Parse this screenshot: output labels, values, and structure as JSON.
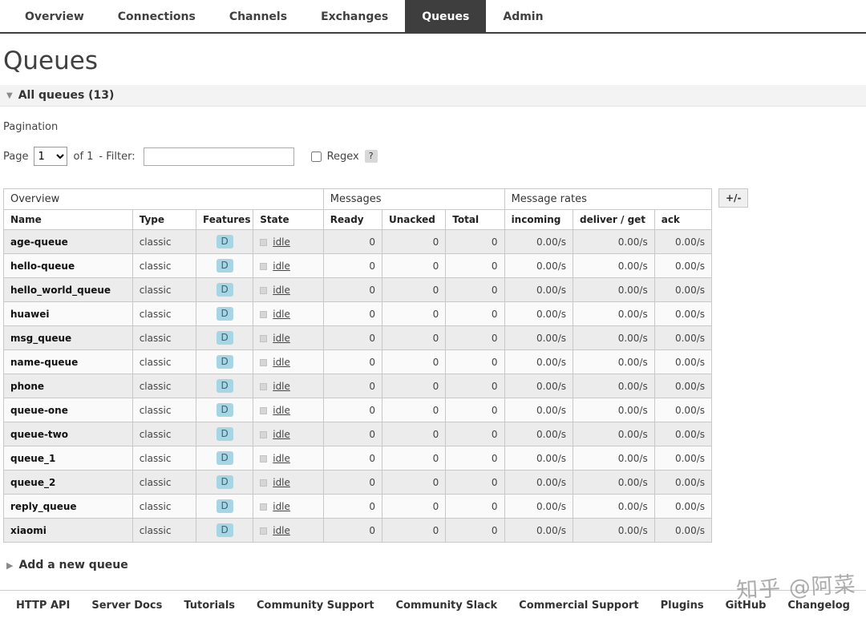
{
  "nav": {
    "tabs": [
      {
        "label": "Overview",
        "active": false
      },
      {
        "label": "Connections",
        "active": false
      },
      {
        "label": "Channels",
        "active": false
      },
      {
        "label": "Exchanges",
        "active": false
      },
      {
        "label": "Queues",
        "active": true
      },
      {
        "label": "Admin",
        "active": false
      }
    ]
  },
  "page": {
    "title": "Queues",
    "section_header": "All queues (13)",
    "pagination_label": "Pagination",
    "page_label": "Page",
    "page_value": "1",
    "of_label": "of 1",
    "filter_label": "- Filter:",
    "filter_value": "",
    "regex_label": "Regex",
    "help_label": "?",
    "add_queue_label": "Add a new queue"
  },
  "icons": {
    "collapse_open": "▼",
    "collapse_closed": "▶"
  },
  "colors": {
    "active_tab_bg": "#3e3e3e",
    "feature_badge_bg": "#a7d5e3",
    "feature_badge_text": "#35677d",
    "row_alt_bg": "#ececec"
  },
  "table": {
    "plusminus": "+/-",
    "groups": [
      {
        "label": "Overview",
        "span": 4
      },
      {
        "label": "Messages",
        "span": 3
      },
      {
        "label": "Message rates",
        "span": 3
      }
    ],
    "columns": [
      "Name",
      "Type",
      "Features",
      "State",
      "Ready",
      "Unacked",
      "Total",
      "incoming",
      "deliver / get",
      "ack"
    ],
    "rows": [
      {
        "name": "age-queue",
        "type": "classic",
        "features": "D",
        "state": "idle",
        "ready": "0",
        "unacked": "0",
        "total": "0",
        "incoming": "0.00/s",
        "deliver_get": "0.00/s",
        "ack": "0.00/s"
      },
      {
        "name": "hello-queue",
        "type": "classic",
        "features": "D",
        "state": "idle",
        "ready": "0",
        "unacked": "0",
        "total": "0",
        "incoming": "0.00/s",
        "deliver_get": "0.00/s",
        "ack": "0.00/s"
      },
      {
        "name": "hello_world_queue",
        "type": "classic",
        "features": "D",
        "state": "idle",
        "ready": "0",
        "unacked": "0",
        "total": "0",
        "incoming": "0.00/s",
        "deliver_get": "0.00/s",
        "ack": "0.00/s"
      },
      {
        "name": "huawei",
        "type": "classic",
        "features": "D",
        "state": "idle",
        "ready": "0",
        "unacked": "0",
        "total": "0",
        "incoming": "0.00/s",
        "deliver_get": "0.00/s",
        "ack": "0.00/s"
      },
      {
        "name": "msg_queue",
        "type": "classic",
        "features": "D",
        "state": "idle",
        "ready": "0",
        "unacked": "0",
        "total": "0",
        "incoming": "0.00/s",
        "deliver_get": "0.00/s",
        "ack": "0.00/s"
      },
      {
        "name": "name-queue",
        "type": "classic",
        "features": "D",
        "state": "idle",
        "ready": "0",
        "unacked": "0",
        "total": "0",
        "incoming": "0.00/s",
        "deliver_get": "0.00/s",
        "ack": "0.00/s"
      },
      {
        "name": "phone",
        "type": "classic",
        "features": "D",
        "state": "idle",
        "ready": "0",
        "unacked": "0",
        "total": "0",
        "incoming": "0.00/s",
        "deliver_get": "0.00/s",
        "ack": "0.00/s"
      },
      {
        "name": "queue-one",
        "type": "classic",
        "features": "D",
        "state": "idle",
        "ready": "0",
        "unacked": "0",
        "total": "0",
        "incoming": "0.00/s",
        "deliver_get": "0.00/s",
        "ack": "0.00/s"
      },
      {
        "name": "queue-two",
        "type": "classic",
        "features": "D",
        "state": "idle",
        "ready": "0",
        "unacked": "0",
        "total": "0",
        "incoming": "0.00/s",
        "deliver_get": "0.00/s",
        "ack": "0.00/s"
      },
      {
        "name": "queue_1",
        "type": "classic",
        "features": "D",
        "state": "idle",
        "ready": "0",
        "unacked": "0",
        "total": "0",
        "incoming": "0.00/s",
        "deliver_get": "0.00/s",
        "ack": "0.00/s"
      },
      {
        "name": "queue_2",
        "type": "classic",
        "features": "D",
        "state": "idle",
        "ready": "0",
        "unacked": "0",
        "total": "0",
        "incoming": "0.00/s",
        "deliver_get": "0.00/s",
        "ack": "0.00/s"
      },
      {
        "name": "reply_queue",
        "type": "classic",
        "features": "D",
        "state": "idle",
        "ready": "0",
        "unacked": "0",
        "total": "0",
        "incoming": "0.00/s",
        "deliver_get": "0.00/s",
        "ack": "0.00/s"
      },
      {
        "name": "xiaomi",
        "type": "classic",
        "features": "D",
        "state": "idle",
        "ready": "0",
        "unacked": "0",
        "total": "0",
        "incoming": "0.00/s",
        "deliver_get": "0.00/s",
        "ack": "0.00/s"
      }
    ]
  },
  "footer": {
    "links": [
      "HTTP API",
      "Server Docs",
      "Tutorials",
      "Community Support",
      "Community Slack",
      "Commercial Support",
      "Plugins",
      "GitHub",
      "Changelog"
    ]
  },
  "watermark": "知乎 @阿菜"
}
